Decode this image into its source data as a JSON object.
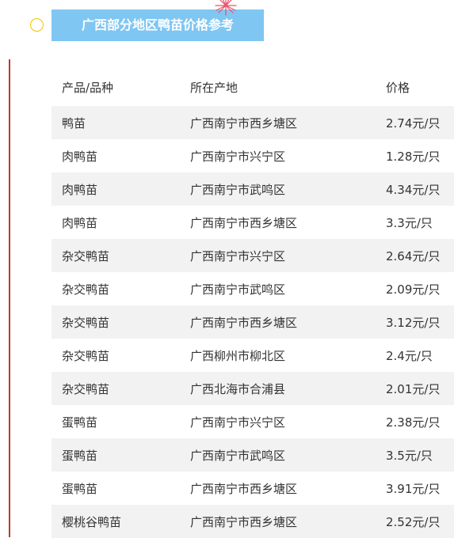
{
  "title": "广西部分地区鸭苗价格参考",
  "colors": {
    "banner": "#7fc6f2",
    "accent_line": "#c0392b",
    "circle": "#f2c200",
    "stripe": "#f2f2f2"
  },
  "table": {
    "headers": [
      "产品/品种",
      "所在产地",
      "价格"
    ],
    "rows": [
      [
        "鸭苗",
        "广西南宁市西乡塘区",
        "2.74元/只"
      ],
      [
        "肉鸭苗",
        "广西南宁市兴宁区",
        "1.28元/只"
      ],
      [
        "肉鸭苗",
        "广西南宁市武鸣区",
        "4.34元/只"
      ],
      [
        "肉鸭苗",
        "广西南宁市西乡塘区",
        "3.3元/只"
      ],
      [
        "杂交鸭苗",
        "广西南宁市兴宁区",
        "2.64元/只"
      ],
      [
        "杂交鸭苗",
        "广西南宁市武鸣区",
        "2.09元/只"
      ],
      [
        "杂交鸭苗",
        "广西南宁市西乡塘区",
        "3.12元/只"
      ],
      [
        "杂交鸭苗",
        "广西柳州市柳北区",
        "2.4元/只"
      ],
      [
        "杂交鸭苗",
        "广西北海市合浦县",
        "2.01元/只"
      ],
      [
        "蛋鸭苗",
        "广西南宁市兴宁区",
        "2.38元/只"
      ],
      [
        "蛋鸭苗",
        "广西南宁市武鸣区",
        "3.5元/只"
      ],
      [
        "蛋鸭苗",
        "广西南宁市西乡塘区",
        "3.91元/只"
      ],
      [
        "樱桃谷鸭苗",
        "广西南宁市西乡塘区",
        "2.52元/只"
      ]
    ]
  }
}
